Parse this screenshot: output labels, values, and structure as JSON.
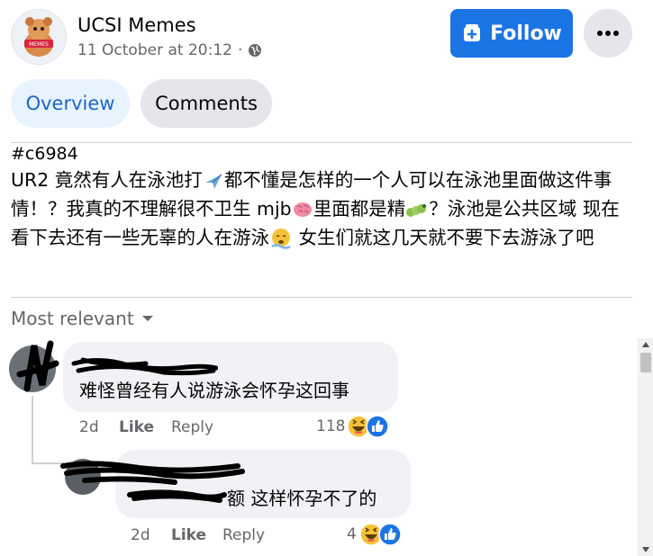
{
  "header": {
    "page_name": "UCSI Memes",
    "timestamp": "11 October at 20:12",
    "meta_separator": "·",
    "follow_label": "Follow",
    "logo_text": "MEMES"
  },
  "tabs": [
    {
      "label": "Overview",
      "active": true
    },
    {
      "label": "Comments",
      "active": false
    }
  ],
  "post": {
    "hashtag": "#c6984",
    "segments": [
      "UR2 竟然有人在泳池打",
      "都不懂是怎样的一个人可以在泳池里面做这件事情！？我真的不理解很不卫生 mjb",
      "里面都是精",
      "？泳池是公共区域 现在看下去还有一些无辜的人在游泳",
      " 女生们就这几天就不要下去游泳了吧"
    ]
  },
  "sort": {
    "label": "Most relevant"
  },
  "comments": [
    {
      "text": "难怪曾经有人说游泳会怀孕这回事",
      "time": "2d",
      "like": "Like",
      "reply": "Reply",
      "reaction_count": "118"
    },
    {
      "text": "额 这样怀孕不了的",
      "time": "2d",
      "like": "Like",
      "reply": "Reply",
      "reaction_count": "4"
    }
  ],
  "colors": {
    "accent": "#1b74e4",
    "tab_active_bg": "#e7f3ff",
    "tab_active_text": "#1b66c9",
    "bubble": "#f0f2f5",
    "muted_text": "#65676b"
  },
  "icons": {
    "meta": "globe-icon",
    "follow": "follow-page-icon",
    "more": "more-options-icon",
    "sort": "chevron-down-icon",
    "reactions": [
      "haha-reaction-icon",
      "like-reaction-icon"
    ]
  }
}
